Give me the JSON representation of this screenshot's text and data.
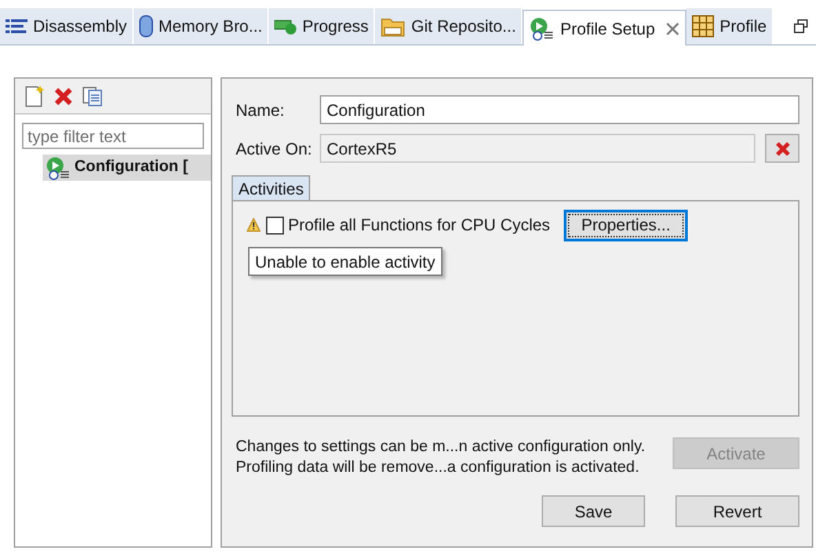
{
  "tabs": [
    {
      "label": "Disassembly",
      "selected": false
    },
    {
      "label": "Memory Bro...",
      "selected": false
    },
    {
      "label": "Progress",
      "selected": false
    },
    {
      "label": "Git Reposito...",
      "selected": false
    },
    {
      "label": "Profile Setup",
      "selected": true
    },
    {
      "label": "Profile",
      "selected": false
    }
  ],
  "sidebar": {
    "filter": {
      "placeholder": "type filter text"
    },
    "items": [
      {
        "label": "Configuration [",
        "selected": true
      }
    ]
  },
  "form": {
    "name_label": "Name:",
    "name_value": "Configuration",
    "active_on_label": "Active On:",
    "active_on_value": "CortexR5"
  },
  "activities": {
    "tab": "Activities",
    "items": [
      {
        "label": "Profile all Functions for CPU Cycles",
        "checked": false,
        "warning": true,
        "button": "Properties...",
        "tooltip": "Unable to enable activity"
      }
    ]
  },
  "footer": {
    "notes": [
      "Changes to settings can be m...n active configuration only.",
      "Profiling data will be remove...a configuration is activated."
    ],
    "activate": {
      "label": "Activate",
      "disabled": true
    },
    "save": "Save",
    "revert": "Revert"
  }
}
